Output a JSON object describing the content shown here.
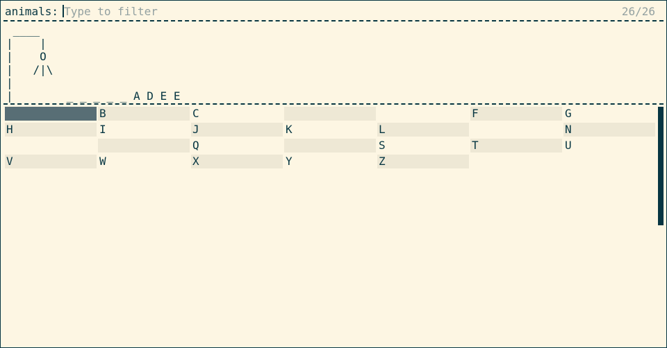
{
  "prompt": {
    "label": "animals:",
    "placeholder": "Type to filter",
    "value": "",
    "count": "26/26"
  },
  "game": {
    "gallows_lines": [
      " ____",
      "|    |",
      "|    O",
      "|   /|\\",
      "|",
      "|        _ _ _ _ _ A D E E"
    ]
  },
  "letters": [
    {
      "label": "",
      "shaded": false,
      "selected": true
    },
    {
      "label": "B",
      "shaded": true,
      "selected": false
    },
    {
      "label": "C",
      "shaded": false,
      "selected": false
    },
    {
      "label": "",
      "shaded": true,
      "selected": false
    },
    {
      "label": "",
      "shaded": false,
      "selected": false
    },
    {
      "label": "F",
      "shaded": true,
      "selected": false
    },
    {
      "label": "G",
      "shaded": false,
      "selected": false
    },
    {
      "label": "H",
      "shaded": true,
      "selected": false
    },
    {
      "label": "I",
      "shaded": false,
      "selected": false
    },
    {
      "label": "J",
      "shaded": true,
      "selected": false
    },
    {
      "label": "K",
      "shaded": false,
      "selected": false
    },
    {
      "label": "L",
      "shaded": true,
      "selected": false
    },
    {
      "label": "",
      "shaded": false,
      "selected": false
    },
    {
      "label": "N",
      "shaded": true,
      "selected": false
    },
    {
      "label": "",
      "shaded": false,
      "selected": false
    },
    {
      "label": "",
      "shaded": true,
      "selected": false
    },
    {
      "label": "Q",
      "shaded": false,
      "selected": false
    },
    {
      "label": "",
      "shaded": true,
      "selected": false
    },
    {
      "label": "S",
      "shaded": false,
      "selected": false
    },
    {
      "label": "T",
      "shaded": true,
      "selected": false
    },
    {
      "label": "U",
      "shaded": false,
      "selected": false
    },
    {
      "label": "V",
      "shaded": true,
      "selected": false
    },
    {
      "label": "W",
      "shaded": false,
      "selected": false
    },
    {
      "label": "X",
      "shaded": true,
      "selected": false
    },
    {
      "label": "Y",
      "shaded": false,
      "selected": false
    },
    {
      "label": "Z",
      "shaded": true,
      "selected": false
    }
  ]
}
